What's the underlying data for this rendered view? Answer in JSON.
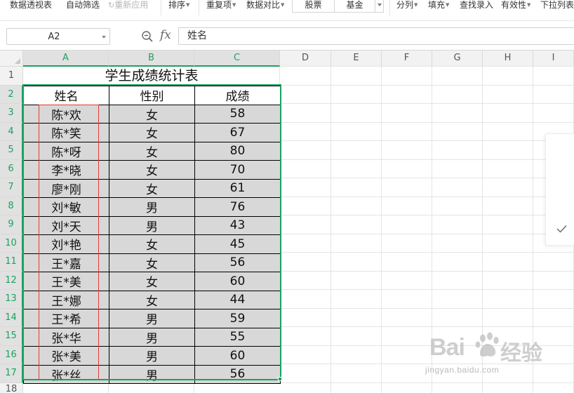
{
  "ribbon": {
    "pivot_table": "数据透视表",
    "auto_filter": "自动筛选",
    "reapply": "重新应用",
    "sort": "排序",
    "duplicates": "重复项",
    "data_compare": "数据对比",
    "stock": "股票",
    "fund": "基金",
    "split": "分列",
    "fill": "填充",
    "find_entry": "查找录入",
    "validity": "有效性",
    "dropdown_list": "下拉列表"
  },
  "formula_bar": {
    "name_box": "A2",
    "fx": "fx",
    "content": "姓名"
  },
  "columns": [
    "A",
    "B",
    "C",
    "D",
    "E",
    "F",
    "G",
    "H",
    "I"
  ],
  "rows": [
    "1",
    "2",
    "3",
    "4",
    "5",
    "6",
    "7",
    "8",
    "9",
    "10",
    "11",
    "12",
    "13",
    "14",
    "15",
    "16",
    "17",
    "18"
  ],
  "sheet": {
    "title": "学生成绩统计表",
    "headers": [
      "姓名",
      "性别",
      "成绩"
    ],
    "records": [
      [
        "陈*欢",
        "女",
        "58"
      ],
      [
        "陈*笑",
        "女",
        "67"
      ],
      [
        "陈*呀",
        "女",
        "80"
      ],
      [
        "李*晓",
        "女",
        "70"
      ],
      [
        "廖*刚",
        "女",
        "61"
      ],
      [
        "刘*敏",
        "男",
        "76"
      ],
      [
        "刘*天",
        "男",
        "43"
      ],
      [
        "刘*艳",
        "女",
        "45"
      ],
      [
        "王*嘉",
        "女",
        "56"
      ],
      [
        "王*美",
        "女",
        "60"
      ],
      [
        "王*娜",
        "女",
        "44"
      ],
      [
        "王*希",
        "男",
        "59"
      ],
      [
        "张*华",
        "男",
        "55"
      ],
      [
        "张*美",
        "男",
        "60"
      ],
      [
        "张*丝",
        "男",
        "56"
      ]
    ]
  },
  "watermark": {
    "brand_left": "Bai",
    "brand_right": "经验",
    "url": "jingyan.baidu.com"
  },
  "colors": {
    "selection": "#1aa260",
    "highlight_box": "#e53935",
    "cell_fill": "#d8d8d8"
  }
}
